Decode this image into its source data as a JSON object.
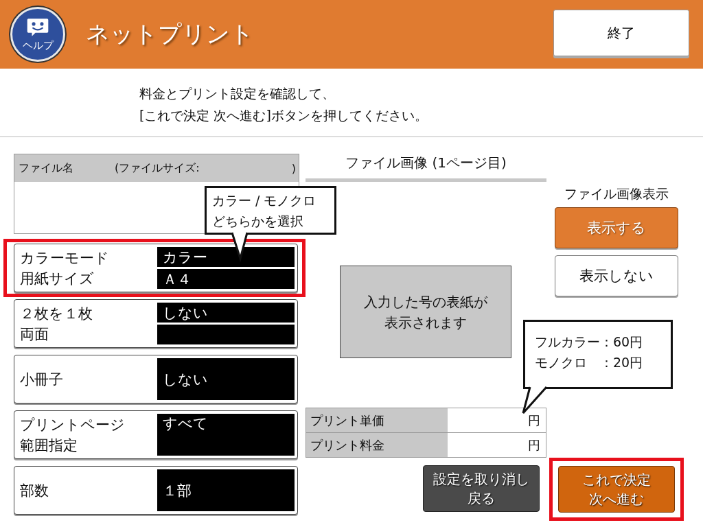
{
  "header": {
    "help_button": "ヘルプ",
    "title": "ネットプリント",
    "exit_button": "終了"
  },
  "instruction": [
    "料金とプリント設定を確認して、",
    "[これで決定 次へ進む]ボタンを押してください。"
  ],
  "file_info": {
    "name_label": "ファイル名",
    "size_label": "(ファイルサイズ:",
    "size_close": ")"
  },
  "settings": [
    {
      "kind": "split",
      "highlighted": true,
      "labels": [
        "カラーモード",
        "用紙サイズ"
      ],
      "values": [
        "カラー",
        "Ａ４"
      ]
    },
    {
      "kind": "split",
      "highlighted": false,
      "labels": [
        "２枚を１枚",
        "両面"
      ],
      "values": [
        "しない"
      ]
    },
    {
      "kind": "tall",
      "highlighted": false,
      "labels": [
        "小冊子"
      ],
      "values": [
        "しない"
      ]
    },
    {
      "kind": "tall",
      "highlighted": false,
      "labels": [
        "プリントページ",
        "範囲指定"
      ],
      "values": [
        "すべて"
      ]
    },
    {
      "kind": "tall",
      "highlighted": false,
      "labels": [
        "部数"
      ],
      "values": [
        "１部"
      ]
    }
  ],
  "preview": {
    "title": "ファイル画像 (1ページ目)",
    "placeholder_lines": [
      "入力した号の表紙が",
      "表示されます"
    ]
  },
  "prices": [
    {
      "label": "プリント単価",
      "value": "円"
    },
    {
      "label": "プリント料金",
      "value": "円"
    }
  ],
  "display_toggle": {
    "label": "ファイル画像表示",
    "options": [
      {
        "label": "表示する",
        "selected": true
      },
      {
        "label": "表示しない",
        "selected": false
      }
    ]
  },
  "actions": [
    {
      "kind": "cancel",
      "lines": [
        "設定を取り消し",
        "戻る"
      ],
      "highlighted": false
    },
    {
      "kind": "confirm",
      "lines": [
        "これで決定",
        "次へ進む"
      ],
      "highlighted": true
    }
  ],
  "callouts": [
    {
      "lines": [
        "カラー / モノクロ",
        "どちらかを選択"
      ]
    },
    {
      "lines": [
        "フルカラー：60円",
        "モノクロ　：20円"
      ]
    }
  ]
}
